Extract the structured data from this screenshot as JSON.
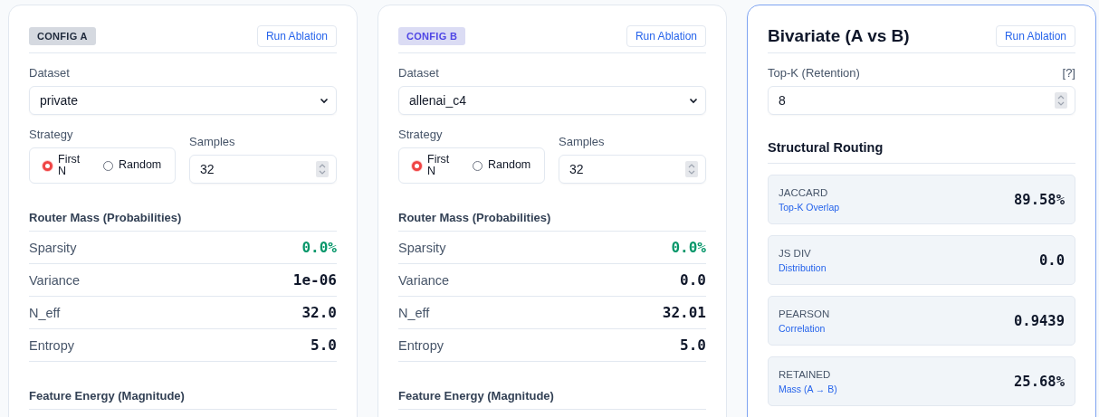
{
  "configs": [
    {
      "badge": "CONFIG A",
      "color": "#1e293b",
      "button": "Run Ablation",
      "dataset_label": "Dataset",
      "dataset": "private",
      "strategy_label": "Strategy",
      "strategies": [
        {
          "label": "First N",
          "selected": true
        },
        {
          "label": "Random",
          "selected": false
        }
      ],
      "samples_label": "Samples",
      "samples": "32",
      "router_title": "Router Mass (Probabilities)",
      "metrics": [
        {
          "label": "Sparsity",
          "value": "0.0%",
          "color": "#059669"
        },
        {
          "label": "Variance",
          "value": "1e-06",
          "color": "#0f172a"
        },
        {
          "label": "N_eff",
          "value": "32.0",
          "color": "#0f172a"
        },
        {
          "label": "Entropy",
          "value": "5.0",
          "color": "#0f172a"
        }
      ],
      "feature_title": "Feature Energy (Magnitude)"
    },
    {
      "badge": "CONFIG B",
      "color": "#4f46e5",
      "button": "Run Ablation",
      "dataset_label": "Dataset",
      "dataset": "allenai_c4",
      "strategy_label": "Strategy",
      "strategies": [
        {
          "label": "First N",
          "selected": true
        },
        {
          "label": "Random",
          "selected": false
        }
      ],
      "samples_label": "Samples",
      "samples": "32",
      "router_title": "Router Mass (Probabilities)",
      "metrics": [
        {
          "label": "Sparsity",
          "value": "0.0%",
          "color": "#059669"
        },
        {
          "label": "Variance",
          "value": "0.0",
          "color": "#0f172a"
        },
        {
          "label": "N_eff",
          "value": "32.01",
          "color": "#0f172a"
        },
        {
          "label": "Entropy",
          "value": "5.0",
          "color": "#0f172a"
        }
      ],
      "feature_title": "Feature Energy (Magnitude)"
    }
  ],
  "comparison": {
    "title": "Bivariate (A vs B)",
    "button": "Run Ablation",
    "topk_label": "Top-K (Retention)",
    "help": "[?]",
    "topk": "8",
    "section_title": "Structural Routing",
    "metrics": [
      {
        "name": "JACCARD",
        "sub": "Top-K Overlap",
        "value": "89.58%"
      },
      {
        "name": "JS DIV",
        "sub": "Distribution",
        "value": "0.0"
      },
      {
        "name": "PEARSON",
        "sub": "Correlation",
        "value": "0.9439"
      },
      {
        "name": "RETAINED",
        "sub": "Mass (A → B)",
        "value": "25.68%"
      }
    ]
  }
}
